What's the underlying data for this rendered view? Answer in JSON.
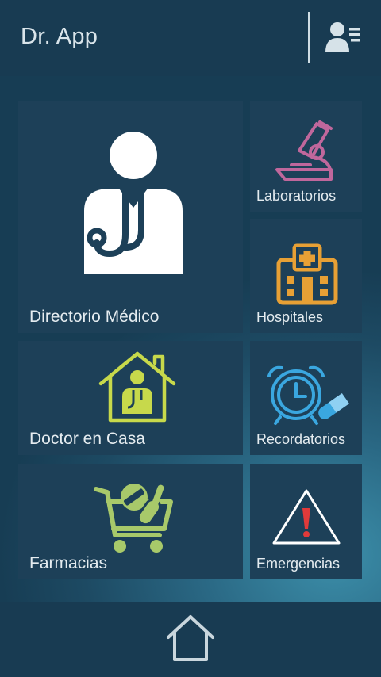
{
  "app": {
    "title": "Dr. App"
  },
  "header": {
    "profile_icon": "profile-card-icon"
  },
  "tiles": {
    "directorio": {
      "label": "Directorio Médico",
      "icon": "doctor-icon"
    },
    "laboratorios": {
      "label": "Laboratorios",
      "icon": "microscope-icon",
      "color": "#c0679c"
    },
    "hospitales": {
      "label": "Hospitales",
      "icon": "hospital-icon",
      "color": "#e7a035"
    },
    "doctor_casa": {
      "label": "Doctor en Casa",
      "icon": "house-doctor-icon",
      "color": "#c7d94b"
    },
    "recordatorios": {
      "label": "Recordatorios",
      "icon": "alarm-clock-pill-icon",
      "color": "#3aa7e0"
    },
    "farmacias": {
      "label": "Farmacias",
      "icon": "cart-pills-icon",
      "color": "#a8c96a"
    },
    "emergencias": {
      "label": "Emergencias",
      "icon": "warning-icon",
      "color": "#e23a3a"
    }
  },
  "footer": {
    "home_icon": "home-icon"
  }
}
